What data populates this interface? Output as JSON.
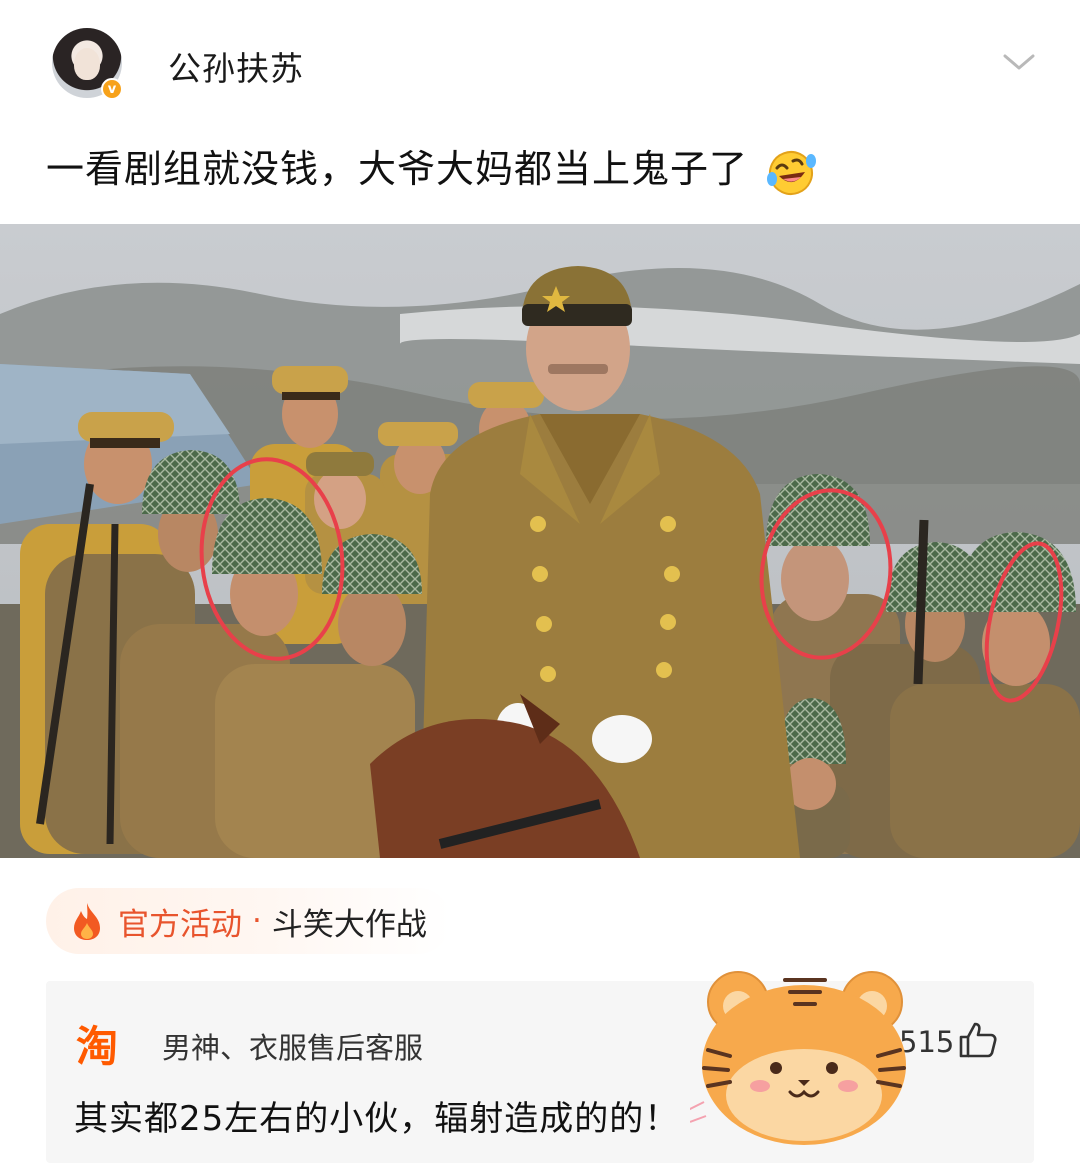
{
  "post": {
    "username": "公孙扶苏",
    "verified_badge": "v",
    "text": "一看剧组就没钱，大爷大妈都当上鬼子了",
    "emoji": "rolling-on-floor-laughing",
    "options_icon": "chevron-down-icon"
  },
  "activity": {
    "icon": "fire-icon",
    "label": "官方活动",
    "separator": "·",
    "name": "斗笑大作战"
  },
  "comment": {
    "source_logo": "淘",
    "author": "男神、衣服售后客服",
    "likes": "515",
    "like_icon": "thumbs-up-icon",
    "text": "其实都25左右的小伙，辐射造成的的！"
  },
  "colors": {
    "accent_orange": "#e8542d",
    "taobao_orange": "#ff5a00",
    "verified_gold": "#f7a21b",
    "circle_annotation": "#e8404a"
  }
}
